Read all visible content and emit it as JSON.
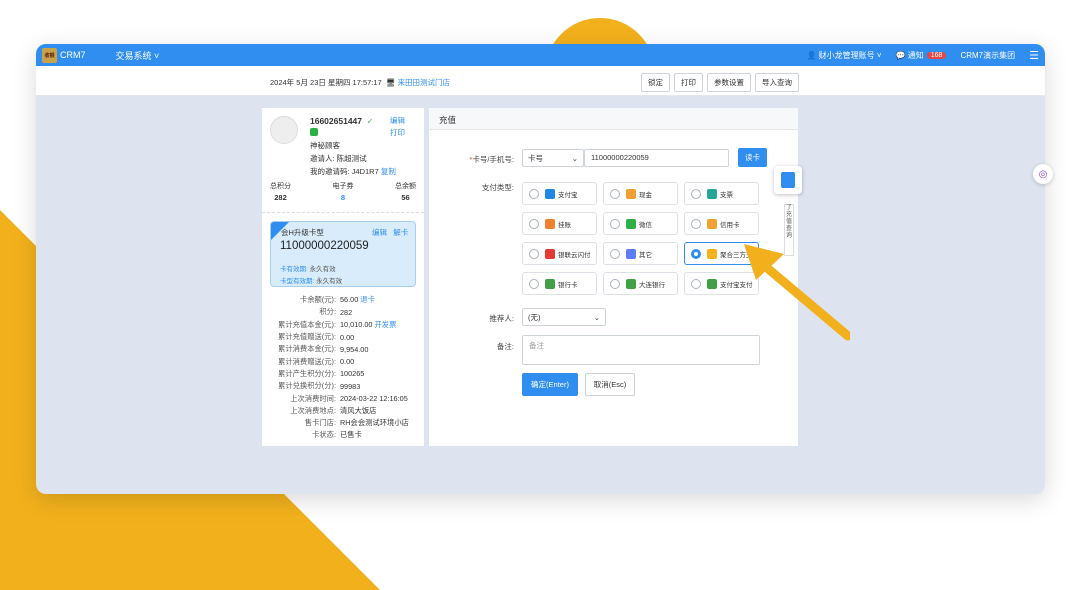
{
  "app": {
    "logo_text": "收银",
    "brand": "CRM7",
    "nav_menu": "交易系统 ˅",
    "account": "财小龙管理账号 ˅",
    "notify_label": "通知",
    "notify_count": "168",
    "org": "CRM7演示集团",
    "menu_icon": "☰"
  },
  "subbar": {
    "datetime": "2024年 5月 23日  星期四  17:57:17",
    "store": "来田田测试门店",
    "buttons": [
      "锁定",
      "打印",
      "参数设置",
      "导入查询"
    ]
  },
  "member": {
    "phone": "16602651447",
    "edit": "编辑",
    "print": "打印",
    "name": "神秘顾客",
    "inviter": "邀请人:   陈超测试",
    "invite_code": "我的邀请码:  J4D1R7",
    "copy": "复制",
    "stats": [
      {
        "label": "总积分",
        "value": "282"
      },
      {
        "label": "电子券",
        "value": "8"
      },
      {
        "label": "总余额",
        "value": "56"
      }
    ]
  },
  "card": {
    "type": "会H升级卡型",
    "edit": "编辑",
    "unbind": "解卡",
    "number": "11000000220059",
    "expire_label": "卡有效期:",
    "expire_value": "永久有效",
    "type_expire_label": "卡型有效期:",
    "type_expire_value": "永久有效"
  },
  "card_info": [
    {
      "k": "卡余额(元):",
      "v": "56.00 ",
      "link": "退卡"
    },
    {
      "k": "积分:",
      "v": "282",
      "link": ""
    },
    {
      "k": "累计充值本金(元):",
      "v": "10,010.00 ",
      "link": "开发票"
    },
    {
      "k": "累计充值赠送(元):",
      "v": "0.00",
      "link": ""
    },
    {
      "k": "累计消费本金(元):",
      "v": "9,954.00",
      "link": ""
    },
    {
      "k": "累计消费赠送(元):",
      "v": "0.00",
      "link": ""
    },
    {
      "k": "累计产生积分(分):",
      "v": "100265",
      "link": ""
    },
    {
      "k": "累计兑换积分(分):",
      "v": "99983",
      "link": ""
    },
    {
      "k": "上次消费时间:",
      "v": "2024-03-22 12:16:05",
      "link": ""
    },
    {
      "k": "上次消费地点:",
      "v": "清风大饭店",
      "link": ""
    },
    {
      "k": "售卡门店:",
      "v": "RH会会测试环境小店",
      "link": ""
    },
    {
      "k": "卡状态:",
      "v": "已售卡",
      "link": ""
    }
  ],
  "recharge": {
    "title": "充值",
    "card_label": "卡号/手机号:",
    "card_type": "卡号",
    "card_value": "11000000220059",
    "read_card": "读卡",
    "pay_label": "支付类型:",
    "pay_options": [
      {
        "label": "支付宝",
        "color": "#1e88e5",
        "selected": false
      },
      {
        "label": "现金",
        "color": "#f0a030",
        "selected": false
      },
      {
        "label": "支票",
        "color": "#26a69a",
        "selected": false
      },
      {
        "label": "挂账",
        "color": "#f08030",
        "selected": false
      },
      {
        "label": "微信",
        "color": "#2cb046",
        "selected": false
      },
      {
        "label": "信用卡",
        "color": "#f0a030",
        "selected": false
      },
      {
        "label": "银联云闪付",
        "color": "#e53935",
        "selected": false
      },
      {
        "label": "其它",
        "color": "#5c7cfa",
        "selected": false
      },
      {
        "label": "聚合三方支",
        "color": "#f5b21c",
        "selected": true
      },
      {
        "label": "银行卡",
        "color": "#43a047",
        "selected": false
      },
      {
        "label": "大连银行",
        "color": "#43a047",
        "selected": false
      },
      {
        "label": "支付宝支付",
        "color": "#43a047",
        "selected": false
      }
    ],
    "referrer_label": "推荐人:",
    "referrer_value": "(无)",
    "remark_label": "备注:",
    "remark_placeholder": "备注",
    "confirm": "确定(Enter)",
    "cancel": "取消(Esc)"
  },
  "side_strip_text": "了充值查询",
  "edge_glyph": "◎"
}
